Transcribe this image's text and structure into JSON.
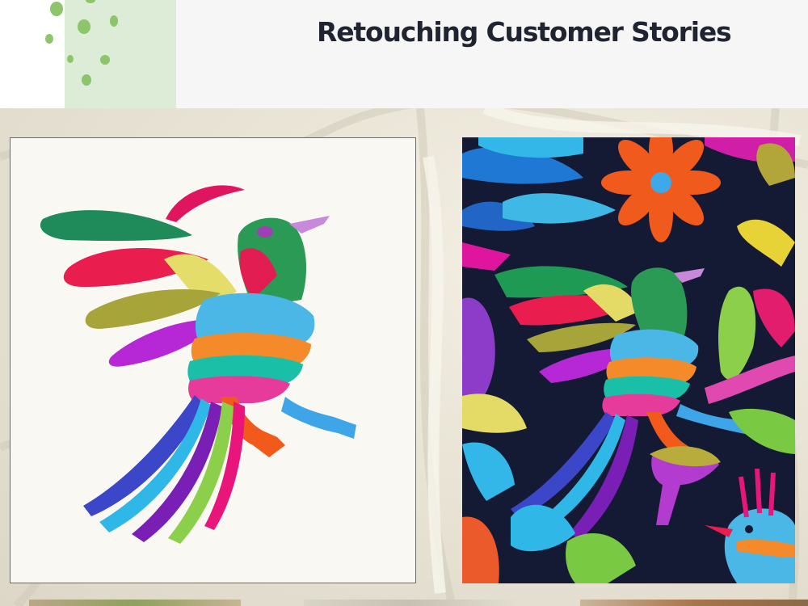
{
  "header": {
    "title": "Retouching Customer Stories",
    "accent_color": "#dcecd6",
    "dot_color": "#8cc56a"
  },
  "showcase": {
    "left_image": "embroidered-bird-isolated-image",
    "right_image": "embroidered-textile-original-image",
    "thumbnails": [
      "thumbnail-image",
      "thumbnail-image",
      "thumbnail-image"
    ]
  }
}
